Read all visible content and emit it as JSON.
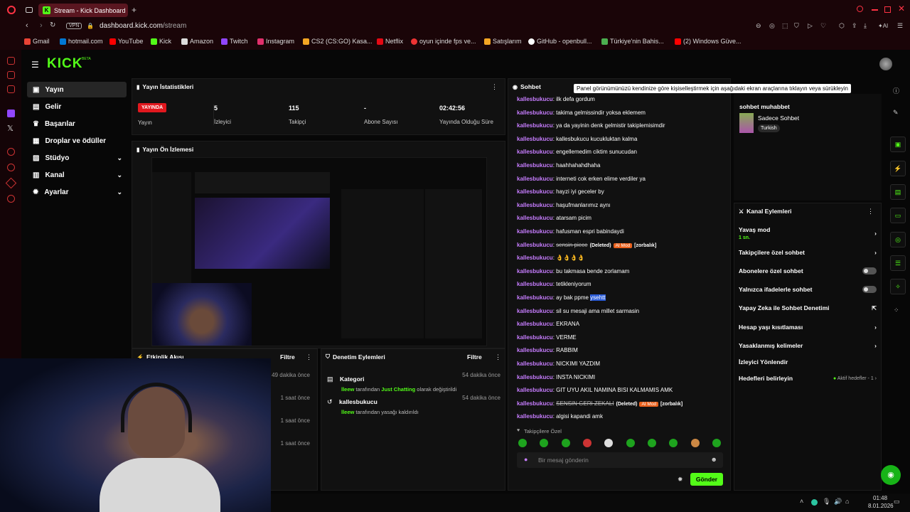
{
  "browser": {
    "tab_title": "Stream - Kick Dashboard",
    "new_tab": "+",
    "url_host": "dashboard.kick.com",
    "url_path": "/stream",
    "vpn": "VPN",
    "ai": "AI",
    "bookmarks": [
      {
        "label": "Gmail",
        "color": "#ea4335"
      },
      {
        "label": "hotmail.com",
        "color": "#0078d4"
      },
      {
        "label": "YouTube",
        "color": "#ff0000"
      },
      {
        "label": "Kick",
        "color": "#53fc18"
      },
      {
        "label": "Amazon",
        "color": "#dddddd"
      },
      {
        "label": "Twitch",
        "color": "#9146ff"
      },
      {
        "label": "Instagram",
        "color": "#e1306c"
      },
      {
        "label": "CS2 (CS:GO) Kasa...",
        "color": "#f5a623"
      },
      {
        "label": "Netflix",
        "color": "#e50914"
      },
      {
        "label": "oyun içinde fps ve...",
        "color": "#e33"
      },
      {
        "label": "Satışlarım",
        "color": "#f5a623"
      },
      {
        "label": "GitHub - openbull...",
        "color": "#ffffff"
      },
      {
        "label": "Türkiye'nin Bahis...",
        "color": "#4caf50"
      },
      {
        "label": "(2) Windows Güve...",
        "color": "#ff0000"
      }
    ]
  },
  "brand": {
    "logo": "KICK",
    "beta": "BETA",
    "accent": "#53fc18"
  },
  "sidebar": {
    "items": [
      {
        "label": "Yayın",
        "icon": "video-icon",
        "active": true
      },
      {
        "label": "Gelir",
        "icon": "money-icon"
      },
      {
        "label": "Başarılar",
        "icon": "trophy-icon"
      },
      {
        "label": "Droplar ve ödüller",
        "icon": "gift-icon"
      },
      {
        "label": "Stüdyo",
        "icon": "studio-icon",
        "chev": "⌄"
      },
      {
        "label": "Kanal",
        "icon": "channel-icon",
        "chev": "⌄"
      },
      {
        "label": "Ayarlar",
        "icon": "gear-icon",
        "chev": "⌄"
      }
    ]
  },
  "stats": {
    "title": "Yayın İstatistikleri",
    "live_badge": "YAYINDA",
    "live_label": "Yayın",
    "viewers": {
      "value": "5",
      "label": "İzleyici"
    },
    "followers": {
      "value": "115",
      "label": "Takipçi"
    },
    "subs": {
      "value": "-",
      "label": "Abone Sayısı"
    },
    "uptime": {
      "value": "02:42:56",
      "label": "Yayında Olduğu Süre"
    }
  },
  "preview": {
    "title": "Yayın Ön İzlemesi"
  },
  "activity": {
    "title": "Etkinlik Akışı",
    "filter": "Filtre",
    "times": [
      "49 dakika önce",
      "1 saat önce",
      "1 saat önce",
      "1 saat önce"
    ]
  },
  "mod": {
    "title": "Denetim Eylemleri",
    "filter": "Filtre",
    "entries": [
      {
        "title": "Kategori",
        "time": "54 dakika önce",
        "actor": "lleew",
        "mid": " tarafından ",
        "hl": "Just Chatting",
        "tail": " olarak değiştirildi"
      },
      {
        "title": "kallesbukucu",
        "time": "54 dakika önce",
        "actor": "lleew",
        "mid": " tarafından yasağı kaldırıldı",
        "hl": "",
        "tail": ""
      }
    ]
  },
  "chat": {
    "title": "Sohbet",
    "tooltip": "Panel görünümünüzü kendinize göre kişiselleştirmek için aşağıdaki ekran araçlarına tıklayın veya sürükleyin",
    "user": "kallesbukucu",
    "messages": [
      {
        "t": "ilk defa gordum"
      },
      {
        "t": "takima gelmissindir yoksa eklemem"
      },
      {
        "t": "ya da yayinin denk gelmistir takiplemisimdir"
      },
      {
        "t": "kallesbukucu kucukluktan kalma"
      },
      {
        "t": "engellemedim ciktim sunucudan"
      },
      {
        "t": "haahhahahdhaha"
      },
      {
        "t": "interneti cok erken elime verdiler ya"
      },
      {
        "t": "hayzi iyi geceler by"
      },
      {
        "t": "haşufmanlarımız aynı"
      },
      {
        "t": "atarsam picim"
      },
      {
        "t": "hafusman espri babindaydi"
      },
      {
        "t": "sensin piece",
        "deleted": "(Deleted)",
        "tag": "AI Mod",
        "reason": "[zorbalık]"
      },
      {
        "t": "👌👌👌👌"
      },
      {
        "t": "bu takmasa bende zorlamam"
      },
      {
        "t": "tetikleniyorum"
      },
      {
        "t": "ay bak ppme ",
        "sel": "ysehtt"
      },
      {
        "t": "sil su mesaji ama millet sarmasin"
      },
      {
        "t": "EKRANA"
      },
      {
        "t": "VERME"
      },
      {
        "t": "RABBIM"
      },
      {
        "t": "NICKIMI YAZDIM"
      },
      {
        "t": "INSTA NICKIMI"
      },
      {
        "t": "GIT UYU AKIL NAMINA BISI KALMAMIS AMK"
      },
      {
        "t": "SENSIN GERI ZEKALI",
        "deleted": "(Deleted)",
        "tag": "AI Mod",
        "reason": "[zorbalık]"
      },
      {
        "t": "algisi kapandi amk"
      }
    ],
    "emote_label": "Takipçilere Özel",
    "input_placeholder": "Bir mesaj gönderin",
    "send": "Gönder"
  },
  "right": {
    "pinned_user": "sohbet muhabbet",
    "pinned_title": "Sadece Sohbet",
    "pinned_lang": "Turkish",
    "actions_title": "Kanal Eylemleri",
    "slow_mode": "Yavaş mod",
    "slow_val": "1 sn.",
    "followers_only": "Takipçilere özel sohbet",
    "subs_only": "Abonelere özel sohbet",
    "emotes_only": "Yalnızca ifadelerle sohbet",
    "ai_mod": "Yapay Zeka ile Sohbet Denetimi",
    "account_age": "Hesap yaşı kısıtlaması",
    "banned_words": "Yasaklanmış kelimeler",
    "viewer_redirect": "İzleyici Yönlendir",
    "goals": "Hedefleri belirleyin",
    "goals_status": "Aktif hedefler - 1"
  },
  "taskbar": {
    "time": "01:48",
    "date": "8.01.2026"
  }
}
